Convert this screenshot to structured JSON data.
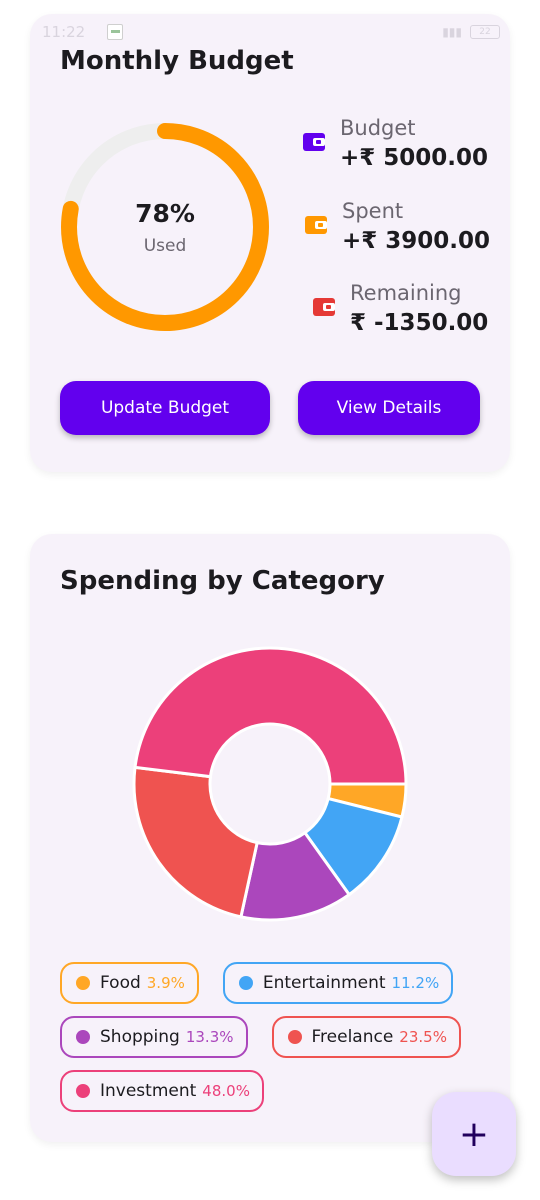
{
  "status_bar": {
    "time": "11:22",
    "battery": "22"
  },
  "budget": {
    "title": "Monthly Budget",
    "percent_used": 78,
    "percent_label": "78%",
    "used_label": "Used",
    "stats": [
      {
        "label": "Budget",
        "value": "+₹ 5000.00",
        "icon": "wallet-icon",
        "color": "#6200ee"
      },
      {
        "label": "Spent",
        "value": "+₹ 3900.00",
        "icon": "wallet-icon",
        "color": "#ff9800"
      },
      {
        "label": "Remaining",
        "value": "₹ -1350.00",
        "icon": "wallet-icon",
        "color": "#e53935"
      }
    ],
    "update_button": "Update Budget",
    "details_button": "View Details",
    "ring_color": "#ff9800",
    "track_color": "#eeeeee"
  },
  "category": {
    "title": "Spending by Category",
    "items": [
      {
        "name": "Food",
        "pct_label": "3.9%",
        "value": 3.9,
        "color": "#ffa726"
      },
      {
        "name": "Entertainment",
        "pct_label": "11.2%",
        "value": 11.2,
        "color": "#42a5f5"
      },
      {
        "name": "Shopping",
        "pct_label": "13.3%",
        "value": 13.3,
        "color": "#ab47bc"
      },
      {
        "name": "Freelance",
        "pct_label": "23.5%",
        "value": 23.5,
        "color": "#ef5350"
      },
      {
        "name": "Investment",
        "pct_label": "48.0%",
        "value": 48.0,
        "color": "#ec407a"
      }
    ]
  },
  "fab": {
    "label": "+",
    "icon": "add-icon"
  }
}
